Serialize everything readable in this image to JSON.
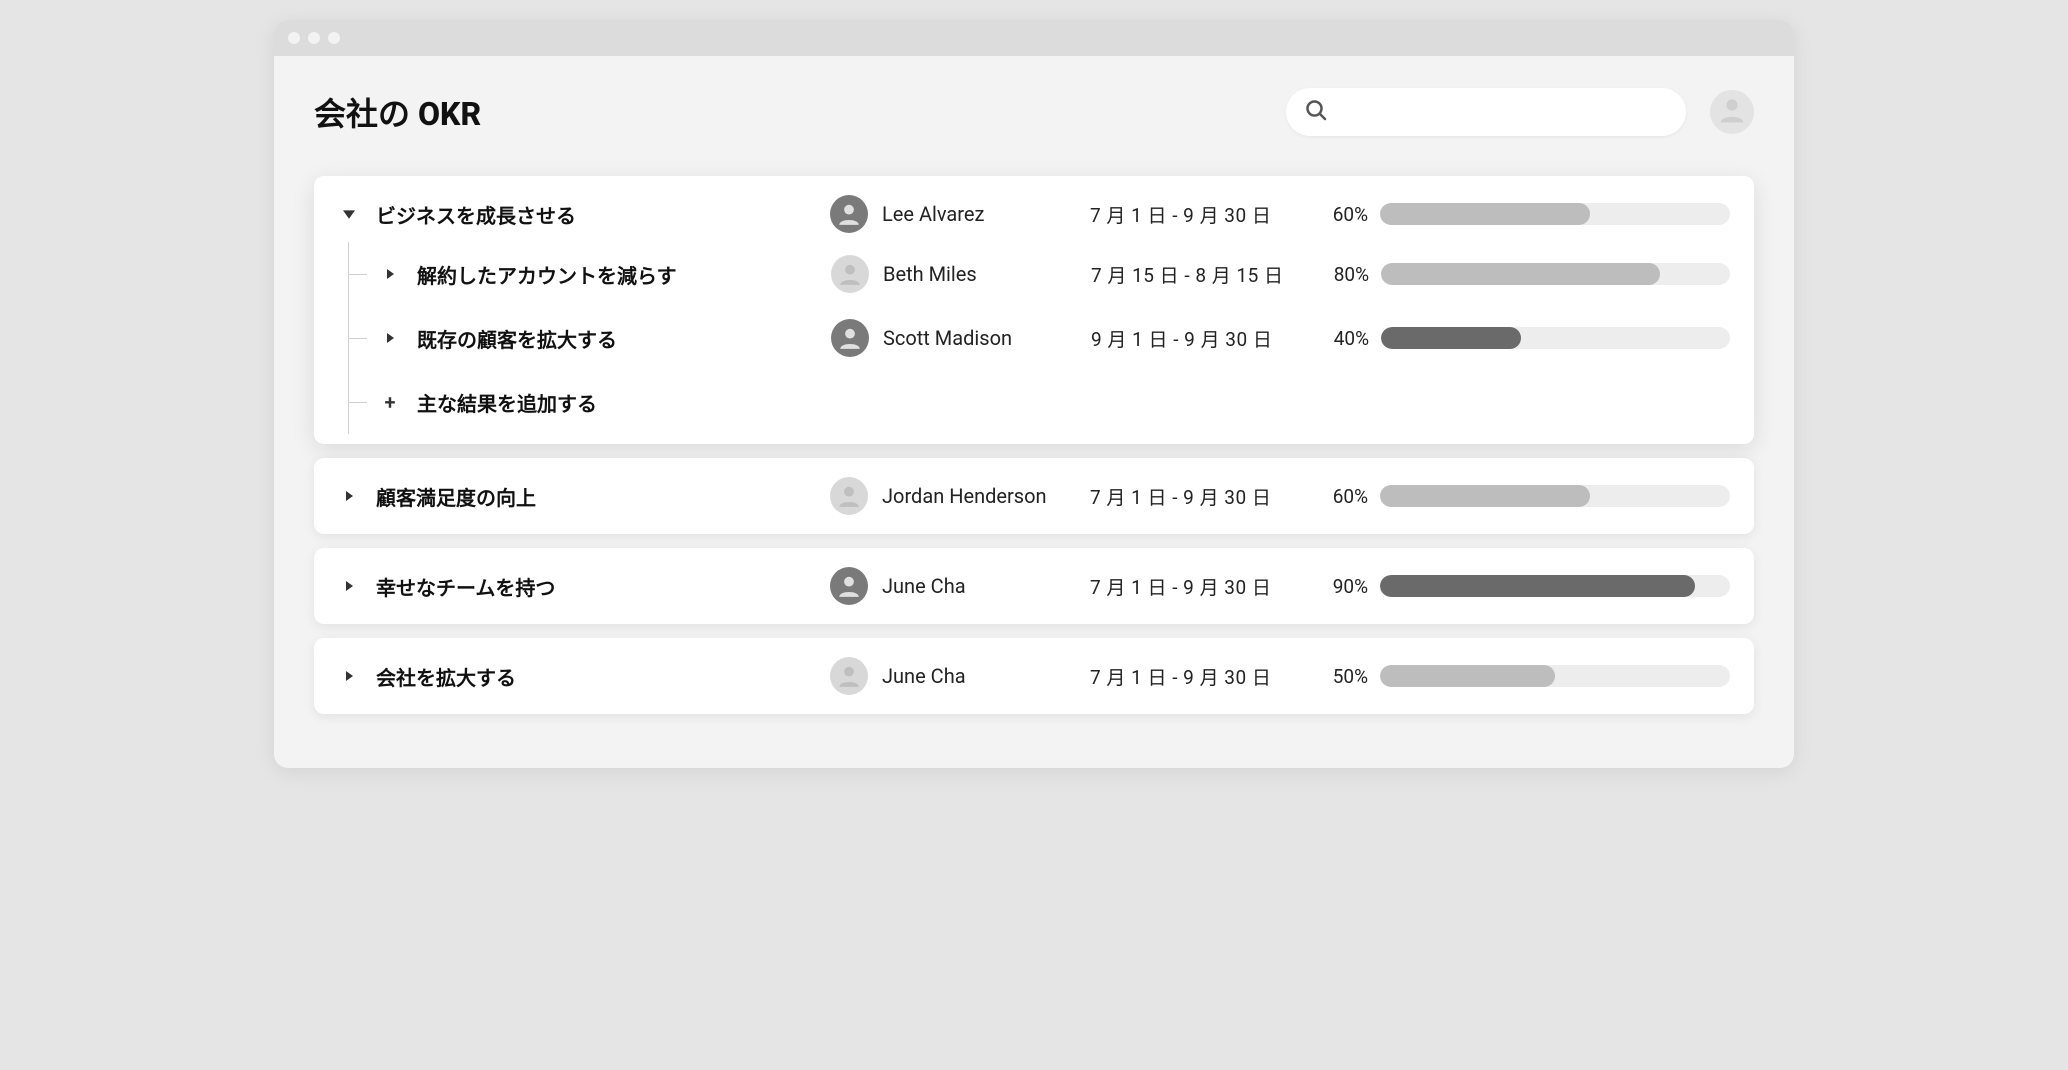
{
  "page": {
    "title": "会社の OKR"
  },
  "search": {
    "placeholder": ""
  },
  "okrs": [
    {
      "label": "ビジネスを成長させる",
      "owner": "Lee Alvarez",
      "avatar_type": "photo",
      "date": "7 月 1 日 - 9 月 30 日",
      "percent": "60%",
      "progress": 60,
      "fill": "light",
      "expanded": true,
      "children": [
        {
          "label": "解約したアカウントを減らす",
          "owner": "Beth Miles",
          "avatar_type": "placeholder",
          "date": "7 月 15 日 - 8 月 15 日",
          "percent": "80%",
          "progress": 80,
          "fill": "light"
        },
        {
          "label": "既存の顧客を拡大する",
          "owner": "Scott Madison",
          "avatar_type": "photo",
          "date": "9 月 1 日 - 9 月 30 日",
          "percent": "40%",
          "progress": 40,
          "fill": "dark"
        }
      ],
      "add_label": "主な結果を追加する"
    },
    {
      "label": "顧客満足度の向上",
      "owner": "Jordan Henderson",
      "avatar_type": "placeholder",
      "date": "7 月 1 日 - 9 月 30 日",
      "percent": "60%",
      "progress": 60,
      "fill": "light",
      "expanded": false
    },
    {
      "label": "幸せなチームを持つ",
      "owner": "June Cha",
      "avatar_type": "photo",
      "date": "7 月 1 日 - 9 月 30 日",
      "percent": "90%",
      "progress": 90,
      "fill": "dark",
      "expanded": false
    },
    {
      "label": "会社を拡大する",
      "owner": "June Cha",
      "avatar_type": "placeholder",
      "date": "7 月 1 日 - 9 月 30 日",
      "percent": "50%",
      "progress": 50,
      "fill": "light",
      "expanded": false
    }
  ]
}
